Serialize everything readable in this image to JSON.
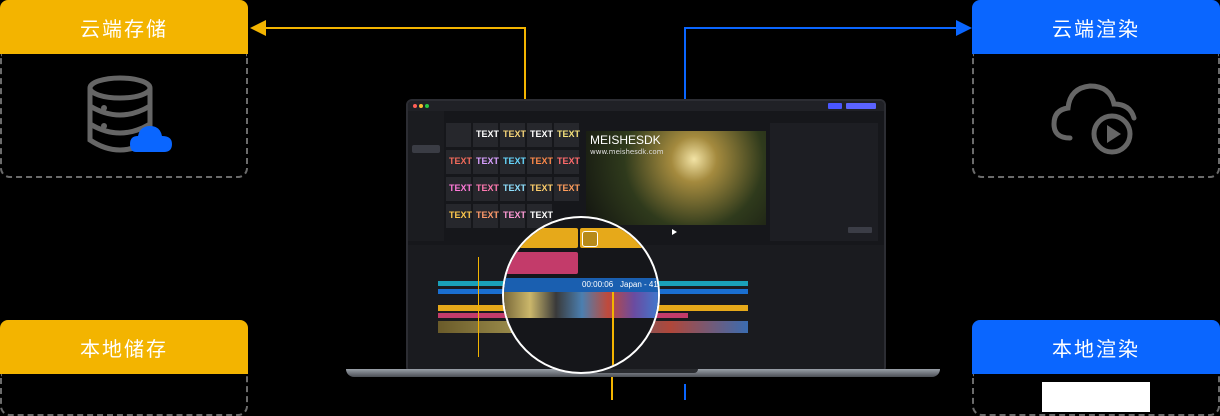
{
  "tiles": {
    "cloud_storage": "云端存储",
    "cloud_render": "云端渲染",
    "local_storage": "本地储存",
    "local_render": "本地渲染"
  },
  "icons": {
    "cloud_storage": "database-cloud-icon",
    "cloud_render": "cloud-play-icon"
  },
  "colors": {
    "yellow": "#f3b400",
    "blue": "#0a66ff"
  },
  "editor": {
    "preview_title": "MEISHESDK",
    "preview_url": "www.meishesdk.com",
    "text_tile": "TEXT",
    "timeline_time": "00:00:06",
    "timeline_clip": "Japan - 41!"
  }
}
